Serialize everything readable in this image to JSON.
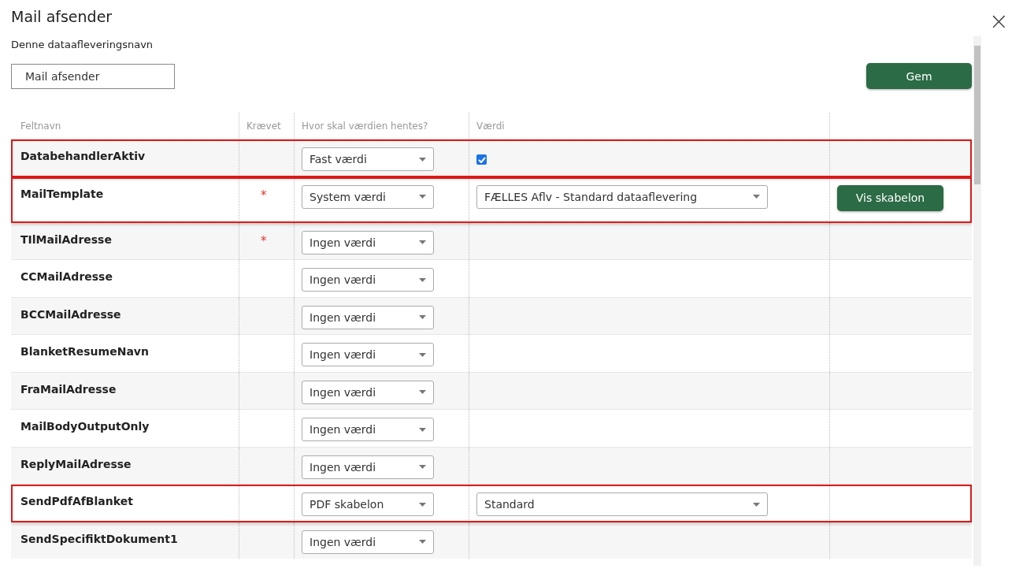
{
  "dialog": {
    "title": "Mail afsender",
    "close_icon": "×",
    "name_label": "Denne dataafleveringsnavn",
    "name_value": "Mail afsender",
    "save_button": "Gem"
  },
  "table": {
    "columns": [
      "Feltnavn",
      "Krævet",
      "Hvor skal værdien hentes?",
      "Værdi"
    ],
    "rows": [
      {
        "kind": "checkbox",
        "name": "DatabehandlerAktiv",
        "source": "Fast værdi",
        "checked": true,
        "highlighted": true
      },
      {
        "kind": "select",
        "name": "MailTemplate",
        "required_mark": "*",
        "source": "System værdi",
        "value": "FÆLLES Aflv - Standard dataaflevering",
        "action": "Vis skabelon",
        "highlighted": true
      },
      {
        "kind": "empty",
        "name": "TIlMailAdresse",
        "required_mark": "*",
        "source": "Ingen værdi",
        "highlighted": false
      },
      {
        "kind": "empty",
        "name": "CCMailAdresse",
        "source": "Ingen værdi",
        "highlighted": false
      },
      {
        "kind": "empty",
        "name": "BCCMailAdresse",
        "source": "Ingen værdi",
        "highlighted": false
      },
      {
        "kind": "empty",
        "name": "BlanketResumeNavn",
        "source": "Ingen værdi",
        "highlighted": false
      },
      {
        "kind": "empty",
        "name": "FraMailAdresse",
        "source": "Ingen værdi",
        "highlighted": false
      },
      {
        "kind": "empty",
        "name": "MailBodyOutputOnly",
        "source": "Ingen værdi",
        "highlighted": false
      },
      {
        "kind": "empty",
        "name": "ReplyMailAdresse",
        "source": "Ingen værdi",
        "highlighted": false
      },
      {
        "kind": "select",
        "name": "SendPdfAfBlanket",
        "source": "PDF skabelon",
        "value": "Standard",
        "highlighted": true
      },
      {
        "kind": "empty",
        "name": "SendSpecifiktDokument1",
        "source": "Ingen værdi",
        "highlighted": false
      }
    ]
  }
}
